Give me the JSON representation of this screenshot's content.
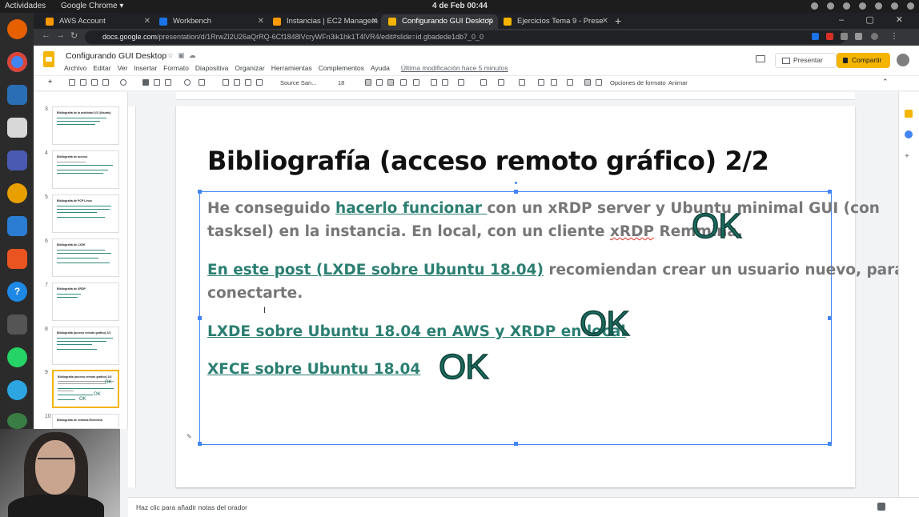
{
  "system": {
    "activities": "Actividades",
    "app_menu": "Google Chrome ▾",
    "clock": "4 de Feb  00:44"
  },
  "browser": {
    "tabs": [
      {
        "label": "AWS Account",
        "active": false
      },
      {
        "label": "Workbench",
        "active": false
      },
      {
        "label": "Instancias | EC2 Managem",
        "active": false
      },
      {
        "label": "Configurando GUI Desktop",
        "active": true
      },
      {
        "label": "Ejercicios Tema 9 - Prese",
        "active": false
      }
    ],
    "url_host": "docs.google.com",
    "url_path": "/presentation/d/1RrwZl2U26aQrRQ-6Cf1848lVcryWFn3ik1hk1T4lVR4/edit#slide=id.gbadede1db7_0_0"
  },
  "document": {
    "title": "Configurando GUI Desktop",
    "menus": [
      "Archivo",
      "Editar",
      "Ver",
      "Insertar",
      "Formato",
      "Diapositiva",
      "Organizar",
      "Herramientas",
      "Complementos",
      "Ayuda"
    ],
    "last_edit": "Última modificación hace 5 minutos",
    "present_label": "Presentar",
    "share_label": "Compartir"
  },
  "toolbar": {
    "font": "Source San...",
    "font_size": "18",
    "format_options": "Opciones de formato",
    "animate": "Animar"
  },
  "filmstrip": {
    "slides": [
      {
        "number": "3",
        "title": "Bibliografía de la actividad 2/2 (Ubuntu)"
      },
      {
        "number": "4",
        "title": "Bibliografía de acceso"
      },
      {
        "number": "5",
        "title": "Bibliografía de PCP Linux"
      },
      {
        "number": "6",
        "title": "Bibliografía de LXDE"
      },
      {
        "number": "7",
        "title": "Bibliografía de XRDP"
      },
      {
        "number": "8",
        "title": "Bibliografía (acceso remoto gráfico) 1/2"
      },
      {
        "number": "9",
        "title": "Bibliografía (acceso remoto gráfico) 2/2"
      },
      {
        "number": "10",
        "title": "Bibliografía de ventana Remmina"
      }
    ]
  },
  "slide": {
    "title": "Bibliografía (acceso remoto gráfico) 2/2",
    "p1_before": "He conseguido ",
    "p1_link": "hacerlo funcionar ",
    "p1_after": "con un xRDP server y Ubuntu minimal GUI (con",
    "p1_line2_before": "tasksel) en la instancia. En local, con un cliente ",
    "p1_line2_sq": "xRDP",
    "p1_line2_after": "  Remmina.",
    "p2_link": "En este post (LXDE sobre Ubuntu 18.04)",
    "p2_after": " recomiendan crear un usuario nuevo, para",
    "p2_line2": "conectarte.",
    "p3_link": "LXDE sobre Ubuntu 18.04 en AWS y XRDP en local",
    "p4_link": "XFCE sobre Ubuntu 18.04",
    "ok": "OK"
  },
  "notes": {
    "placeholder": "Haz clic para añadir notas del orador"
  }
}
